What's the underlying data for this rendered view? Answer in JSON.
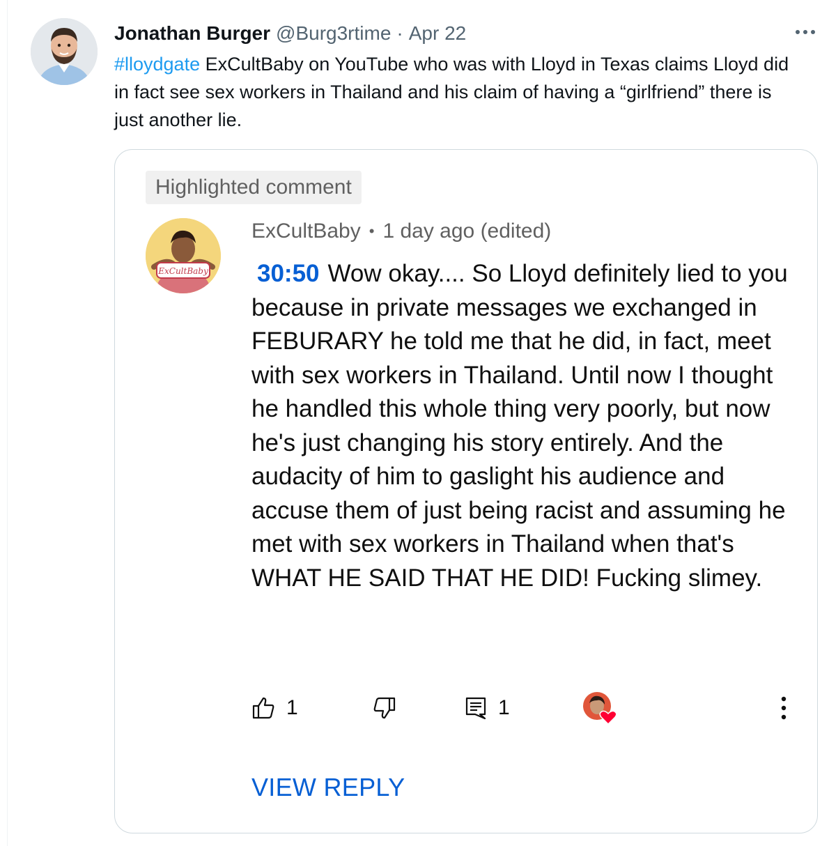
{
  "tweet": {
    "display_name": "Jonathan Burger",
    "handle": "@Burg3rtime",
    "separator": "·",
    "date": "Apr 22",
    "hashtag": "#lloydgate",
    "text": " ExCultBaby on YouTube who was with Lloyd in Texas claims Lloyd did in fact see sex workers in Thailand and his claim of having a “girlfriend” there is just another lie.",
    "more_icon": "more-horizontal-icon"
  },
  "embedded_comment": {
    "badge": "Highlighted comment",
    "avatar_text": "ExCultBaby",
    "author": "ExCultBaby",
    "dot": "•",
    "time": "1 day ago (edited)",
    "timestamp_link": "30:50",
    "body": "Wow okay.... So Lloyd definitely lied to you because in private messages we exchanged in FEBURARY he told me that he did, in fact, meet with sex workers in Thailand. Until now I thought he handled this whole thing very poorly, but now he's just changing his story entirely. And the audacity of him to gaslight his audience and accuse them of just being racist and assuming he met with sex workers in Thailand when that's WHAT HE SAID THAT HE DID! Fucking slimey.",
    "actions": {
      "like_count": "1",
      "reply_count": "1"
    },
    "view_reply": "VIEW REPLY",
    "colors": {
      "link_blue": "#065fd4",
      "twitter_blue": "#1d9bf0",
      "heart_red": "#ff0033"
    }
  }
}
